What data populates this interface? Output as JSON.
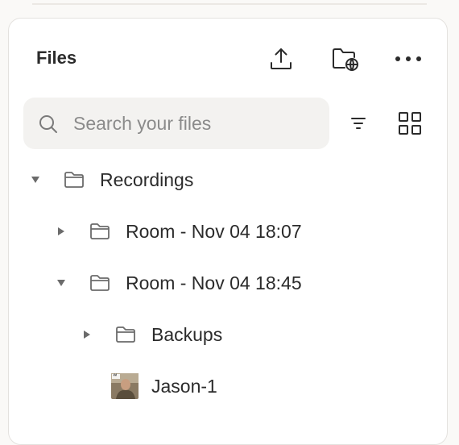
{
  "panel": {
    "title": "Files"
  },
  "toolbar": {
    "upload_icon": "upload-icon",
    "shared_folder_icon": "folder-globe-icon",
    "more_icon": "more-horizontal-icon",
    "filter_icon": "filter-lines-icon",
    "grid_icon": "grid-view-icon"
  },
  "search": {
    "placeholder": "Search your files",
    "value": ""
  },
  "tree": {
    "items": [
      {
        "label": "Recordings",
        "expanded": true,
        "type": "folder"
      },
      {
        "label": "Room - Nov 04 18:07",
        "expanded": false,
        "type": "folder"
      },
      {
        "label": "Room - Nov 04 18:45",
        "expanded": true,
        "type": "folder"
      },
      {
        "label": "Backups",
        "expanded": false,
        "type": "folder"
      },
      {
        "label": "Jason-1",
        "type": "file"
      }
    ]
  },
  "colors": {
    "panel_bg": "#ffffff",
    "search_bg": "#f3f2f0",
    "icon": "#6b6b6b",
    "text": "#2b2b2b"
  }
}
